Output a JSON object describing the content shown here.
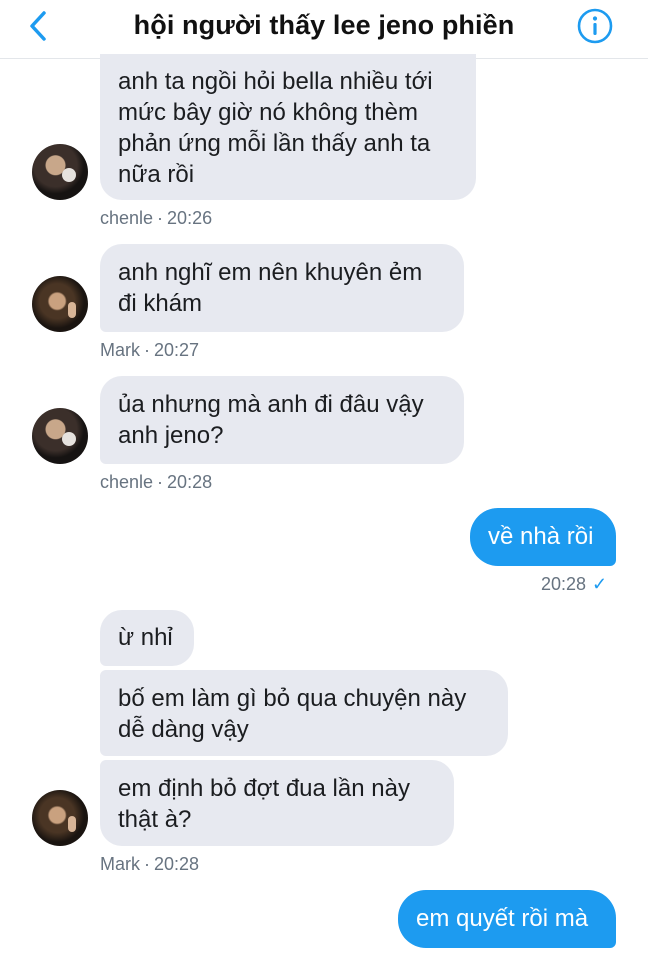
{
  "header": {
    "title": "hội người thấy lee jeno phiền",
    "accent": "#1d9bf0"
  },
  "messages": [
    {
      "text": "anh ta ngồi hỏi bella nhiều tới mức bây giờ nó không thèm phản ứng mỗi lần thấy anh ta nữa rồi",
      "sender": "chenle",
      "time": "20:26"
    },
    {
      "text": "anh nghĩ em nên khuyên ẻm đi khám",
      "sender": "Mark",
      "time": "20:27"
    },
    {
      "text": "ủa nhưng mà anh đi đâu vậy anh jeno?",
      "sender": "chenle",
      "time": "20:28"
    },
    {
      "text": "về nhà rồi",
      "time": "20:28",
      "read_mark": "✓"
    },
    {
      "text": "ừ nhỉ"
    },
    {
      "text": "bố em làm gì bỏ qua chuyện này dễ dàng vậy"
    },
    {
      "text": "em định bỏ đợt đua lần này thật à?",
      "sender": "Mark",
      "time": "20:28"
    },
    {
      "text": "em quyết rồi mà"
    }
  ],
  "meta_separator": "·"
}
